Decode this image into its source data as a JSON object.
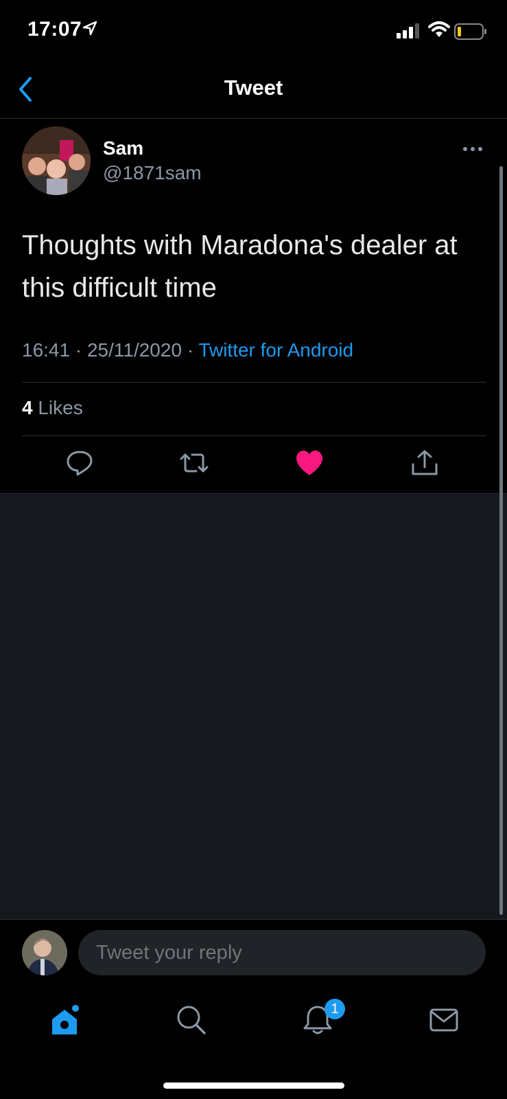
{
  "status_bar": {
    "time": "17:07"
  },
  "header": {
    "title": "Tweet"
  },
  "tweet": {
    "author_name": "Sam",
    "author_handle": "@1871sam",
    "text": "Thoughts with Maradona's dealer at this difficult time",
    "time": "16:41",
    "separator": "·",
    "date": "25/11/2020",
    "source": "Twitter for Android",
    "likes_count": "4",
    "likes_label": "Likes",
    "liked": true
  },
  "reply": {
    "placeholder": "Tweet your reply"
  },
  "tab_bar": {
    "notifications_badge": "1"
  },
  "colors": {
    "accent": "#1d9bf0",
    "like": "#f91880",
    "background": "#000000",
    "secondary_text": "#8b98a5",
    "lower_area": "#15181c"
  },
  "icons": {
    "back": "chevron-left-icon",
    "more": "more-horizontal-icon",
    "reply": "speech-bubble-icon",
    "retweet": "retweet-icon",
    "like": "heart-icon",
    "share": "share-icon",
    "home": "home-icon",
    "search": "search-icon",
    "notifications": "bell-icon",
    "messages": "envelope-icon"
  }
}
